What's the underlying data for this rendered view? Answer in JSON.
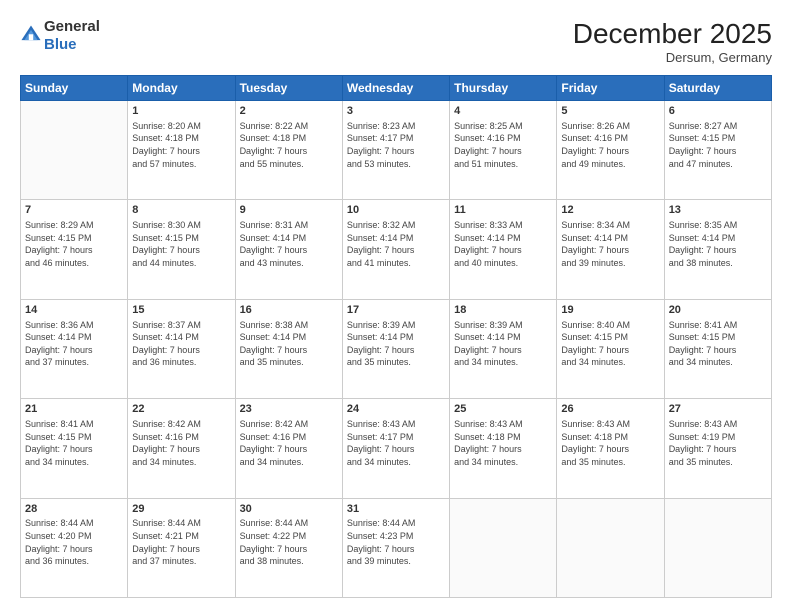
{
  "header": {
    "logo_line1": "General",
    "logo_line2": "Blue",
    "month": "December 2025",
    "location": "Dersum, Germany"
  },
  "days_of_week": [
    "Sunday",
    "Monday",
    "Tuesday",
    "Wednesday",
    "Thursday",
    "Friday",
    "Saturday"
  ],
  "weeks": [
    [
      {
        "day": "",
        "info": ""
      },
      {
        "day": "1",
        "info": "Sunrise: 8:20 AM\nSunset: 4:18 PM\nDaylight: 7 hours\nand 57 minutes."
      },
      {
        "day": "2",
        "info": "Sunrise: 8:22 AM\nSunset: 4:18 PM\nDaylight: 7 hours\nand 55 minutes."
      },
      {
        "day": "3",
        "info": "Sunrise: 8:23 AM\nSunset: 4:17 PM\nDaylight: 7 hours\nand 53 minutes."
      },
      {
        "day": "4",
        "info": "Sunrise: 8:25 AM\nSunset: 4:16 PM\nDaylight: 7 hours\nand 51 minutes."
      },
      {
        "day": "5",
        "info": "Sunrise: 8:26 AM\nSunset: 4:16 PM\nDaylight: 7 hours\nand 49 minutes."
      },
      {
        "day": "6",
        "info": "Sunrise: 8:27 AM\nSunset: 4:15 PM\nDaylight: 7 hours\nand 47 minutes."
      }
    ],
    [
      {
        "day": "7",
        "info": "Sunrise: 8:29 AM\nSunset: 4:15 PM\nDaylight: 7 hours\nand 46 minutes."
      },
      {
        "day": "8",
        "info": "Sunrise: 8:30 AM\nSunset: 4:15 PM\nDaylight: 7 hours\nand 44 minutes."
      },
      {
        "day": "9",
        "info": "Sunrise: 8:31 AM\nSunset: 4:14 PM\nDaylight: 7 hours\nand 43 minutes."
      },
      {
        "day": "10",
        "info": "Sunrise: 8:32 AM\nSunset: 4:14 PM\nDaylight: 7 hours\nand 41 minutes."
      },
      {
        "day": "11",
        "info": "Sunrise: 8:33 AM\nSunset: 4:14 PM\nDaylight: 7 hours\nand 40 minutes."
      },
      {
        "day": "12",
        "info": "Sunrise: 8:34 AM\nSunset: 4:14 PM\nDaylight: 7 hours\nand 39 minutes."
      },
      {
        "day": "13",
        "info": "Sunrise: 8:35 AM\nSunset: 4:14 PM\nDaylight: 7 hours\nand 38 minutes."
      }
    ],
    [
      {
        "day": "14",
        "info": "Sunrise: 8:36 AM\nSunset: 4:14 PM\nDaylight: 7 hours\nand 37 minutes."
      },
      {
        "day": "15",
        "info": "Sunrise: 8:37 AM\nSunset: 4:14 PM\nDaylight: 7 hours\nand 36 minutes."
      },
      {
        "day": "16",
        "info": "Sunrise: 8:38 AM\nSunset: 4:14 PM\nDaylight: 7 hours\nand 35 minutes."
      },
      {
        "day": "17",
        "info": "Sunrise: 8:39 AM\nSunset: 4:14 PM\nDaylight: 7 hours\nand 35 minutes."
      },
      {
        "day": "18",
        "info": "Sunrise: 8:39 AM\nSunset: 4:14 PM\nDaylight: 7 hours\nand 34 minutes."
      },
      {
        "day": "19",
        "info": "Sunrise: 8:40 AM\nSunset: 4:15 PM\nDaylight: 7 hours\nand 34 minutes."
      },
      {
        "day": "20",
        "info": "Sunrise: 8:41 AM\nSunset: 4:15 PM\nDaylight: 7 hours\nand 34 minutes."
      }
    ],
    [
      {
        "day": "21",
        "info": "Sunrise: 8:41 AM\nSunset: 4:15 PM\nDaylight: 7 hours\nand 34 minutes."
      },
      {
        "day": "22",
        "info": "Sunrise: 8:42 AM\nSunset: 4:16 PM\nDaylight: 7 hours\nand 34 minutes."
      },
      {
        "day": "23",
        "info": "Sunrise: 8:42 AM\nSunset: 4:16 PM\nDaylight: 7 hours\nand 34 minutes."
      },
      {
        "day": "24",
        "info": "Sunrise: 8:43 AM\nSunset: 4:17 PM\nDaylight: 7 hours\nand 34 minutes."
      },
      {
        "day": "25",
        "info": "Sunrise: 8:43 AM\nSunset: 4:18 PM\nDaylight: 7 hours\nand 34 minutes."
      },
      {
        "day": "26",
        "info": "Sunrise: 8:43 AM\nSunset: 4:18 PM\nDaylight: 7 hours\nand 35 minutes."
      },
      {
        "day": "27",
        "info": "Sunrise: 8:43 AM\nSunset: 4:19 PM\nDaylight: 7 hours\nand 35 minutes."
      }
    ],
    [
      {
        "day": "28",
        "info": "Sunrise: 8:44 AM\nSunset: 4:20 PM\nDaylight: 7 hours\nand 36 minutes."
      },
      {
        "day": "29",
        "info": "Sunrise: 8:44 AM\nSunset: 4:21 PM\nDaylight: 7 hours\nand 37 minutes."
      },
      {
        "day": "30",
        "info": "Sunrise: 8:44 AM\nSunset: 4:22 PM\nDaylight: 7 hours\nand 38 minutes."
      },
      {
        "day": "31",
        "info": "Sunrise: 8:44 AM\nSunset: 4:23 PM\nDaylight: 7 hours\nand 39 minutes."
      },
      {
        "day": "",
        "info": ""
      },
      {
        "day": "",
        "info": ""
      },
      {
        "day": "",
        "info": ""
      }
    ]
  ]
}
